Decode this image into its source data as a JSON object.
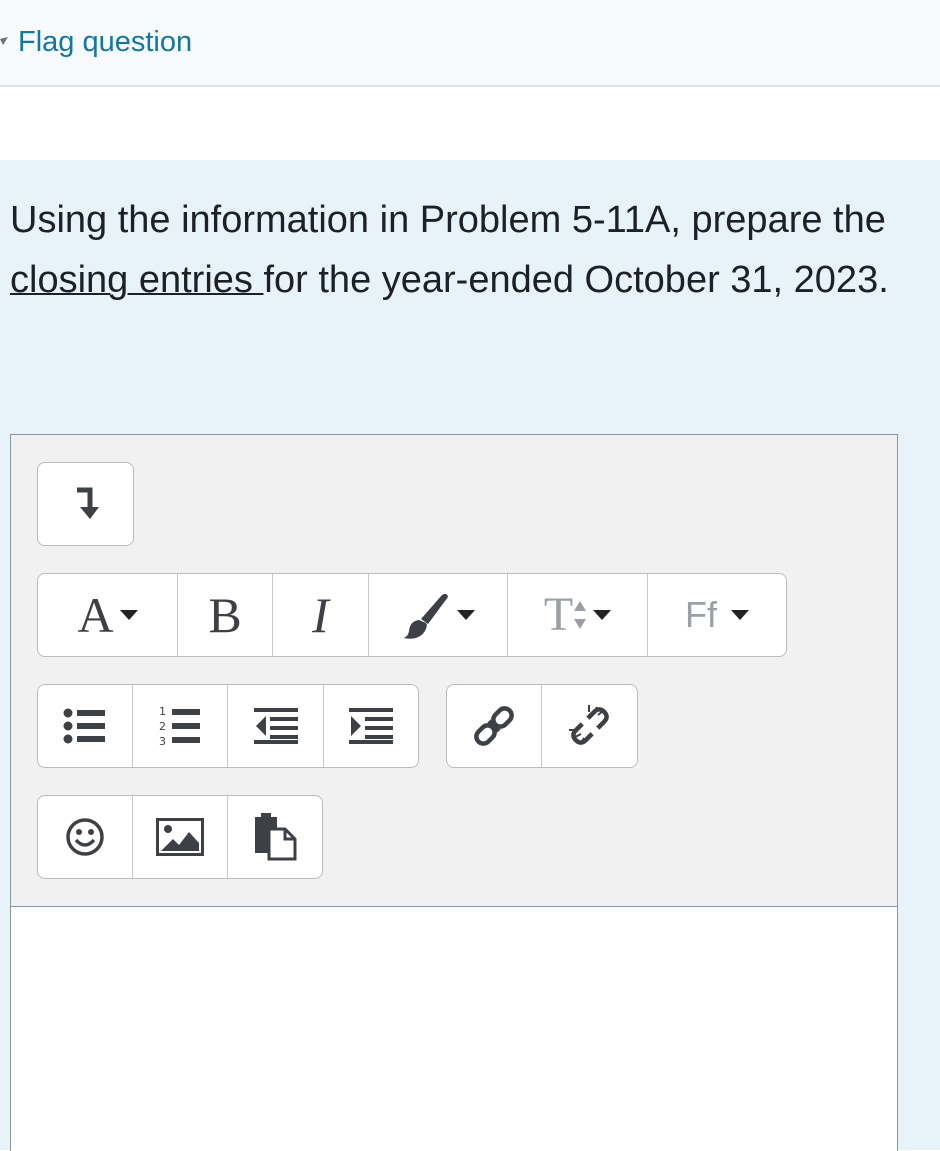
{
  "flag": {
    "label": "Flag question",
    "icon": "flag-icon"
  },
  "question": {
    "text_before": "Using the information in Problem 5-11A, prepare the ",
    "text_underlined": "closing entries ",
    "text_after": "for the year-ended October 31, 2023."
  },
  "editor": {
    "toolbar": [
      {
        "group": "show-more",
        "buttons": [
          "show-more-icon"
        ]
      },
      {
        "group": "style",
        "buttons": [
          "paragraph-styles-icon",
          "bold-icon",
          "italic-icon",
          "text-color-icon",
          "font-size-icon",
          "font-family-icon"
        ]
      },
      {
        "group": "lists",
        "buttons": [
          "unordered-list-icon",
          "ordered-list-icon",
          "outdent-icon",
          "indent-icon"
        ]
      },
      {
        "group": "links",
        "buttons": [
          "link-icon",
          "unlink-icon"
        ]
      },
      {
        "group": "insert",
        "buttons": [
          "emoji-icon",
          "image-icon",
          "media-manager-icon"
        ]
      }
    ],
    "labels": {
      "paragraph_styles": "A",
      "bold": "B",
      "italic": "I",
      "font_size": "T",
      "font_family": "Ff"
    },
    "content": ""
  }
}
